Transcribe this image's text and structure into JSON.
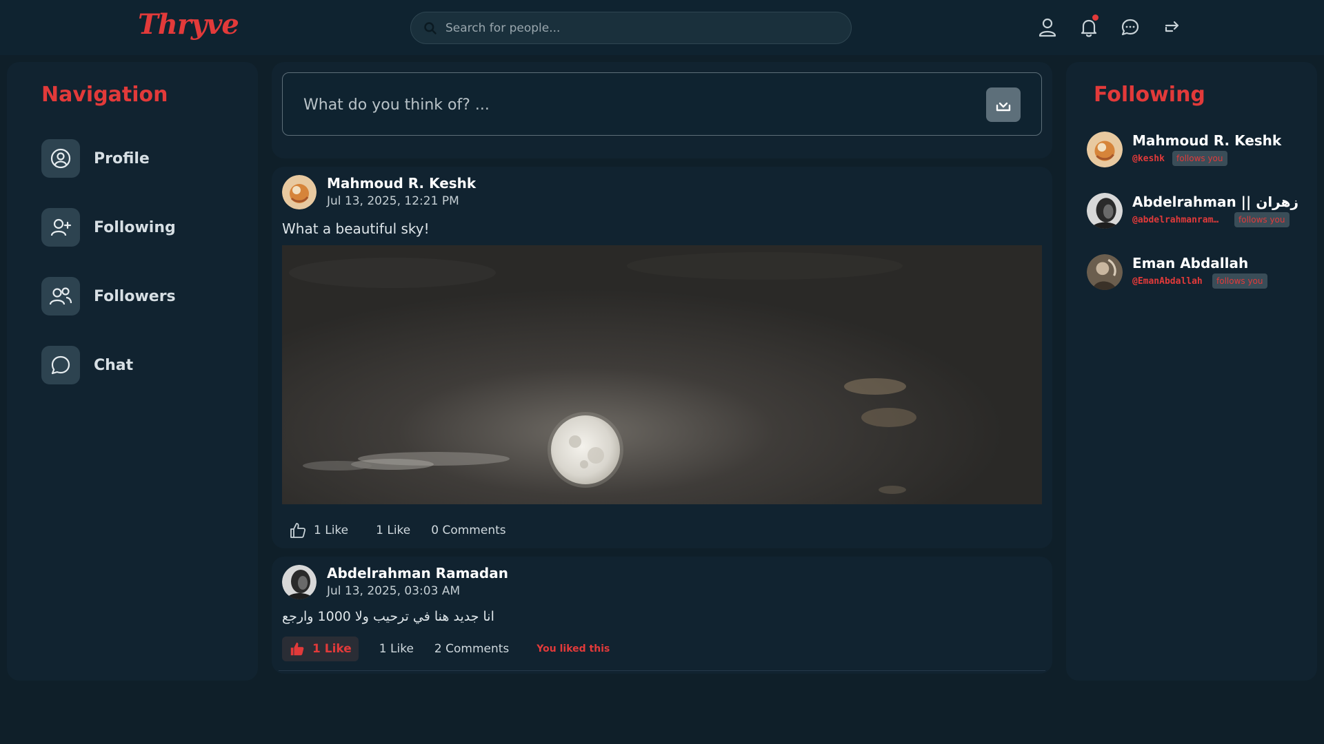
{
  "app": {
    "logo_text": "Thryve",
    "accent_color": "#e23a3a"
  },
  "search": {
    "placeholder": "Search for people..."
  },
  "header_icons": [
    "profile-icon",
    "bell-icon",
    "chat-bubble-icon",
    "logout-icon"
  ],
  "navigation": {
    "title": "Navigation",
    "items": [
      {
        "label": "Profile",
        "icon": "user-circle-icon"
      },
      {
        "label": "Following",
        "icon": "user-plus-icon"
      },
      {
        "label": "Followers",
        "icon": "users-icon"
      },
      {
        "label": "Chat",
        "icon": "chat-bubble-icon"
      }
    ]
  },
  "composer": {
    "placeholder": "What do you think of? ...",
    "submit_icon": "download-tray-icon"
  },
  "posts": [
    {
      "author": "Mahmoud R. Keshk",
      "time": "Jul 13, 2025, 12:21 PM",
      "text": "What a beautiful sky!",
      "image": "full-moon-night-sky",
      "like_label": "1 Like",
      "likes_count_label": "1 Like",
      "comments_label": "0 Comments",
      "liked_by_you": false
    },
    {
      "author": "Abdelrahman Ramadan",
      "time": "Jul 13, 2025, 03:03 AM",
      "text": "انا جديد هنا في ترحيب ولا 1000 وارجع",
      "like_label": "1 Like",
      "likes_count_label": "1 Like",
      "comments_label": "2 Comments",
      "liked_by_you": true,
      "liked_note": "You liked this"
    }
  ],
  "following": {
    "title": "Following",
    "items": [
      {
        "name": "Mahmoud R. Keshk",
        "handle": "@keshk",
        "badge": "follows you"
      },
      {
        "name": "Abdelrahman || زهران",
        "handle": "@abdelrahmanram…",
        "badge": "follows you"
      },
      {
        "name": "Eman Abdallah",
        "handle": "@EmanAbdallah",
        "badge": "follows you"
      }
    ]
  }
}
